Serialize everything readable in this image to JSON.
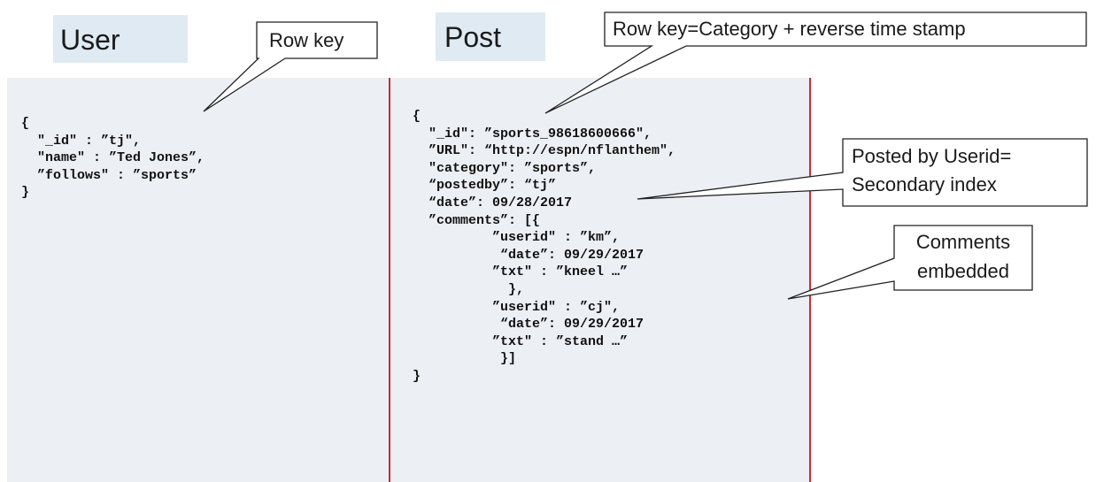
{
  "user": {
    "title": "User",
    "code": "{\n  \"_id\" : ”tj\",\n  \"name\" : ”Ted Jones”,\n  ”follows\" : ”sports”\n}"
  },
  "post": {
    "title": "Post",
    "code": "{\n  \"_id\": ”sports_98618600666\",\n  ”URL\": “http://espn/nflanthem\",\n  \"category\": ”sports”,\n  “postedby”: “tj”\n  “date”: 09/28/2017\n  ”comments”: [{\n          ”userid\" : ”km”,\n           “date”: 09/29/2017\n          ”txt\" : ”kneel …”\n            },\n          ”userid\" : ”cj\",\n           “date”: 09/29/2017\n          ”txt\" : ”stand …”\n           }]\n}"
  },
  "callouts": {
    "row_key": "Row key",
    "row_key_post": "Row key=Category + reverse time stamp",
    "posted_by_line1": "Posted by Userid=",
    "posted_by_line2": "Secondary index",
    "comments_line1": "Comments",
    "comments_line2": "embedded"
  },
  "colors": {
    "panel": "#eceff4",
    "title_box": "#dfeaf2",
    "divider": "#cc2a3a"
  }
}
